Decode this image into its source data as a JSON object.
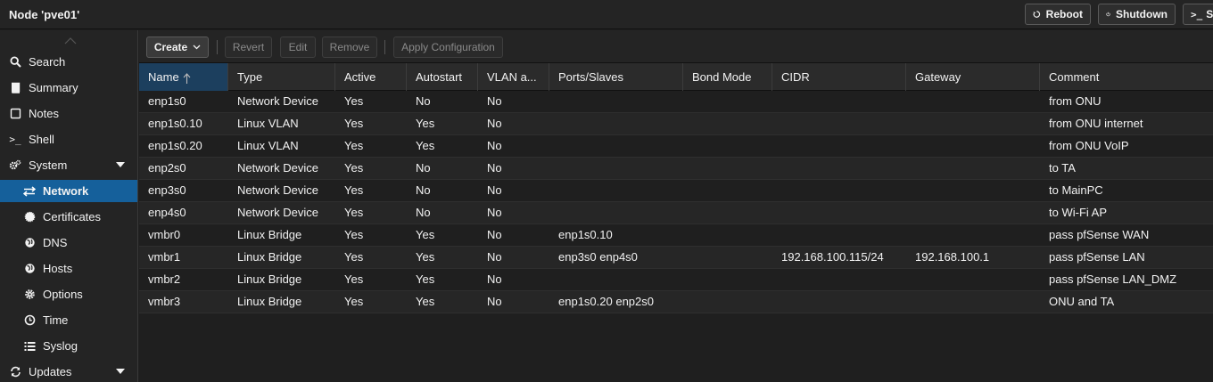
{
  "header": {
    "node_title": "Node 'pve01'",
    "reboot_label": "Reboot",
    "shutdown_label": "Shutdown",
    "shell_label": "S"
  },
  "sidebar": {
    "items": [
      {
        "label": "Search",
        "icon": "search-icon"
      },
      {
        "label": "Summary",
        "icon": "book-icon"
      },
      {
        "label": "Notes",
        "icon": "note-icon"
      },
      {
        "label": "Shell",
        "icon": "terminal-icon"
      },
      {
        "label": "System",
        "icon": "cogs-icon"
      },
      {
        "label": "Network",
        "icon": "exchange-icon"
      },
      {
        "label": "Certificates",
        "icon": "certificate-icon"
      },
      {
        "label": "DNS",
        "icon": "globe-icon"
      },
      {
        "label": "Hosts",
        "icon": "globe-icon"
      },
      {
        "label": "Options",
        "icon": "gear-icon"
      },
      {
        "label": "Time",
        "icon": "clock-icon"
      },
      {
        "label": "Syslog",
        "icon": "list-icon"
      },
      {
        "label": "Updates",
        "icon": "refresh-icon"
      }
    ]
  },
  "toolbar": {
    "create_label": "Create",
    "revert_label": "Revert",
    "edit_label": "Edit",
    "remove_label": "Remove",
    "apply_label": "Apply Configuration"
  },
  "grid": {
    "columns": [
      "Name",
      "Type",
      "Active",
      "Autostart",
      "VLAN a...",
      "Ports/Slaves",
      "Bond Mode",
      "CIDR",
      "Gateway",
      "Comment"
    ],
    "rows": [
      [
        "enp1s0",
        "Network Device",
        "Yes",
        "No",
        "No",
        "",
        "",
        "",
        "",
        "from ONU"
      ],
      [
        "enp1s0.10",
        "Linux VLAN",
        "Yes",
        "Yes",
        "No",
        "",
        "",
        "",
        "",
        "from ONU internet"
      ],
      [
        "enp1s0.20",
        "Linux VLAN",
        "Yes",
        "Yes",
        "No",
        "",
        "",
        "",
        "",
        "from ONU VoIP"
      ],
      [
        "enp2s0",
        "Network Device",
        "Yes",
        "No",
        "No",
        "",
        "",
        "",
        "",
        "to TA"
      ],
      [
        "enp3s0",
        "Network Device",
        "Yes",
        "No",
        "No",
        "",
        "",
        "",
        "",
        "to MainPC"
      ],
      [
        "enp4s0",
        "Network Device",
        "Yes",
        "No",
        "No",
        "",
        "",
        "",
        "",
        "to Wi-Fi AP"
      ],
      [
        "vmbr0",
        "Linux Bridge",
        "Yes",
        "Yes",
        "No",
        "enp1s0.10",
        "",
        "",
        "",
        "pass pfSense WAN"
      ],
      [
        "vmbr1",
        "Linux Bridge",
        "Yes",
        "Yes",
        "No",
        "enp3s0 enp4s0",
        "",
        "192.168.100.115/24",
        "192.168.100.1",
        "pass pfSense LAN"
      ],
      [
        "vmbr2",
        "Linux Bridge",
        "Yes",
        "Yes",
        "No",
        "",
        "",
        "",
        "",
        "pass pfSense LAN_DMZ"
      ],
      [
        "vmbr3",
        "Linux Bridge",
        "Yes",
        "Yes",
        "No",
        "enp1s0.20 enp2s0",
        "",
        "",
        "",
        "ONU and TA"
      ]
    ]
  },
  "colors": {
    "accent": "#15609b",
    "sorted_header": "#1c3f5e",
    "background": "#1f1f1f"
  }
}
